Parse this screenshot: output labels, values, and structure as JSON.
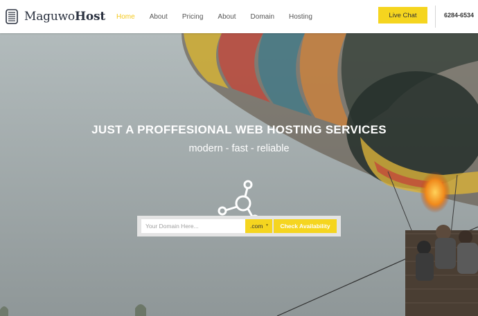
{
  "brand": {
    "name_regular": "Maguwo",
    "name_bold": "Host",
    "icon": "server-icon"
  },
  "nav": {
    "items": [
      {
        "label": "Home",
        "active": true
      },
      {
        "label": "About",
        "active": false
      },
      {
        "label": "Pricing",
        "active": false
      },
      {
        "label": "About",
        "active": false
      },
      {
        "label": "Domain",
        "active": false
      },
      {
        "label": "Hosting",
        "active": false
      }
    ]
  },
  "header": {
    "live_chat_label": "Live Chat",
    "phone": "6284-6534"
  },
  "hero": {
    "title": "JUST A PROFFESIONAL WEB HOSTING SERVICES",
    "subtitle": "modern - fast - reliable",
    "icon": "share-network-icon"
  },
  "search": {
    "placeholder": "Your Domain Here...",
    "tld": ".com",
    "button_label": "Check Availability"
  },
  "colors": {
    "accent": "#f5d51f",
    "nav_active": "#f4c81c",
    "text_dark": "#2b3240"
  }
}
